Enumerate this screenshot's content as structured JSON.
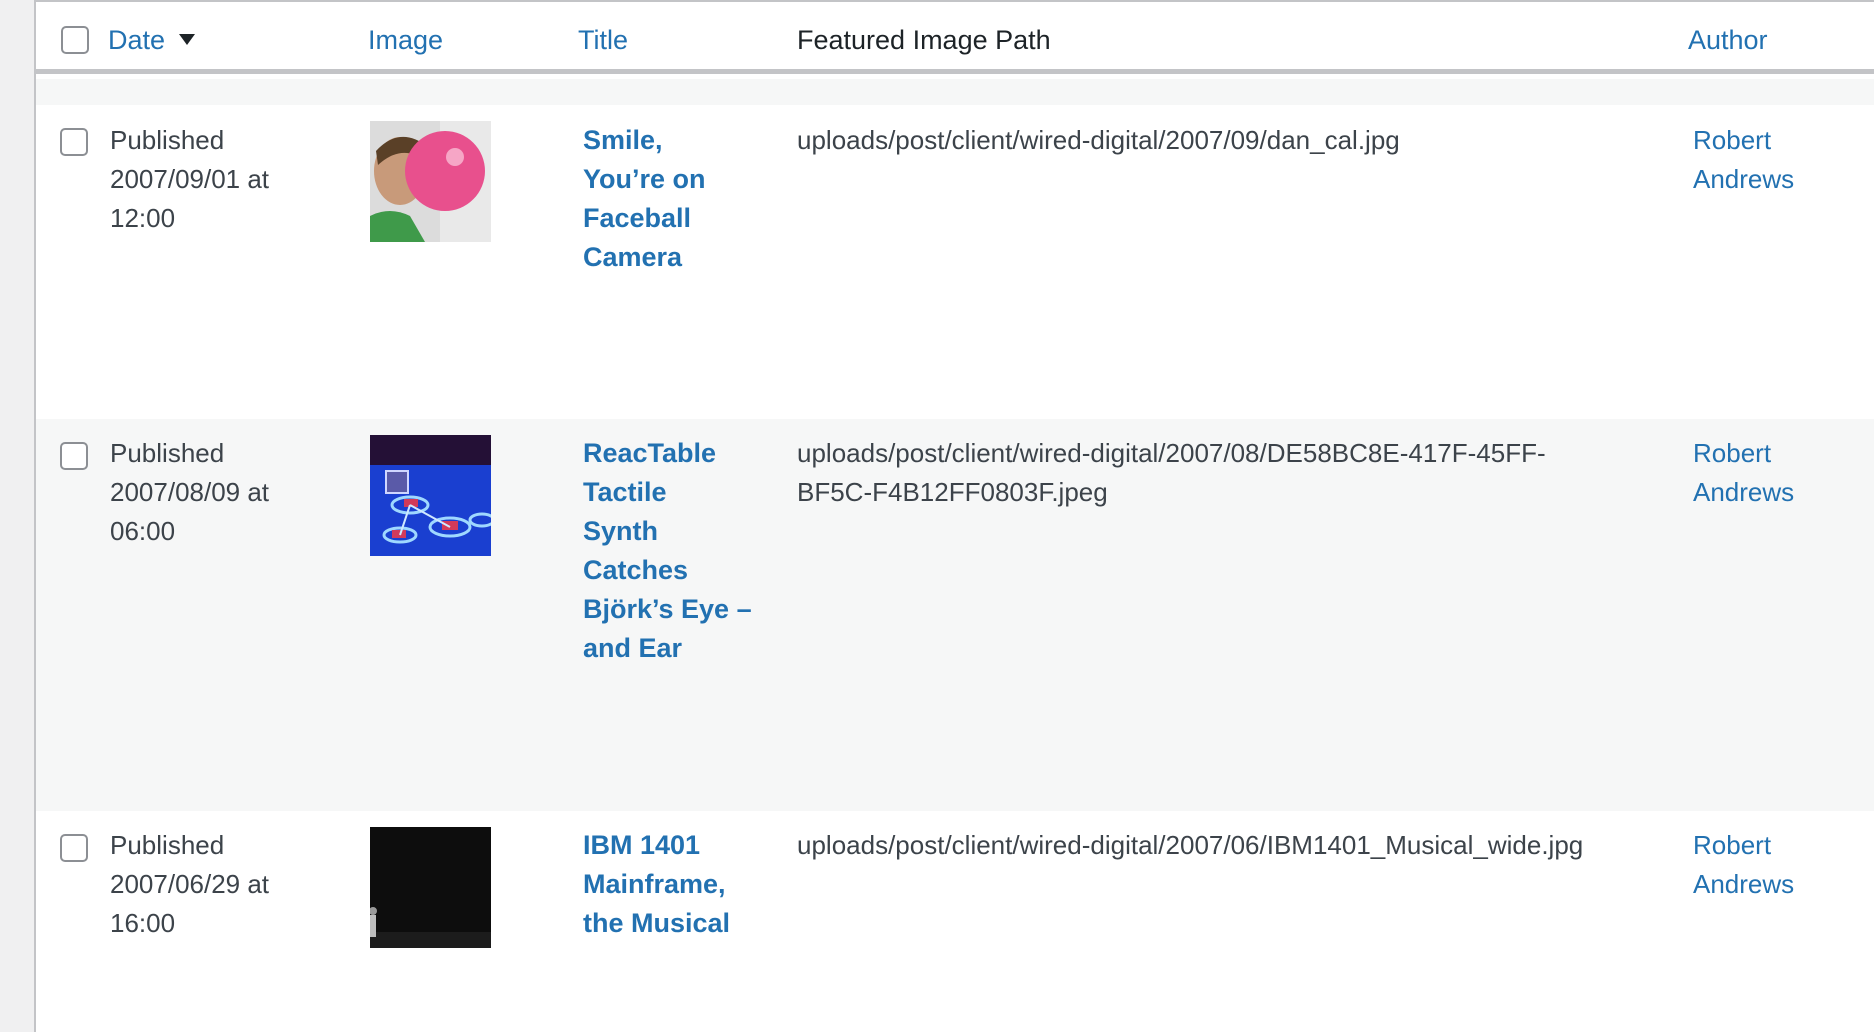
{
  "table": {
    "columns": {
      "date": "Date",
      "image": "Image",
      "title": "Title",
      "path": "Featured Image Path",
      "author": "Author"
    },
    "rows": [
      {
        "status": "Published",
        "date": "2007/09/01 at",
        "time": "12:00",
        "title_lines": [
          "Smile,",
          "You’re on",
          "Faceball",
          "Camera"
        ],
        "path": "uploads/post/client/wired-digital/2007/09/dan_cal.jpg",
        "author_first": "Robert",
        "author_last": "Andrews"
      },
      {
        "status": "Published",
        "date": "2007/08/09 at",
        "time": "06:00",
        "title_lines": [
          "ReacTable",
          "Tactile",
          "Synth",
          "Catches",
          "Björk’s Eye –",
          "and Ear"
        ],
        "path_line1": "uploads/post/client/wired-digital/2007/08/DE58BC8E-417F-45FF-",
        "path_line2": "BF5C-F4B12FF0803F.jpeg",
        "author_first": "Robert",
        "author_last": "Andrews"
      },
      {
        "status": "Published",
        "date": "2007/06/29 at",
        "time": "16:00",
        "title_lines": [
          "IBM 1401",
          "Mainframe,",
          "the Musical"
        ],
        "path": "uploads/post/client/wired-digital/2007/06/IBM1401_Musical_wide.jpg",
        "author_first": "Robert",
        "author_last": "Andrews"
      }
    ]
  },
  "colors": {
    "link": "#2271b1",
    "text": "#3c434a",
    "alt_row": "#f6f7f7"
  }
}
